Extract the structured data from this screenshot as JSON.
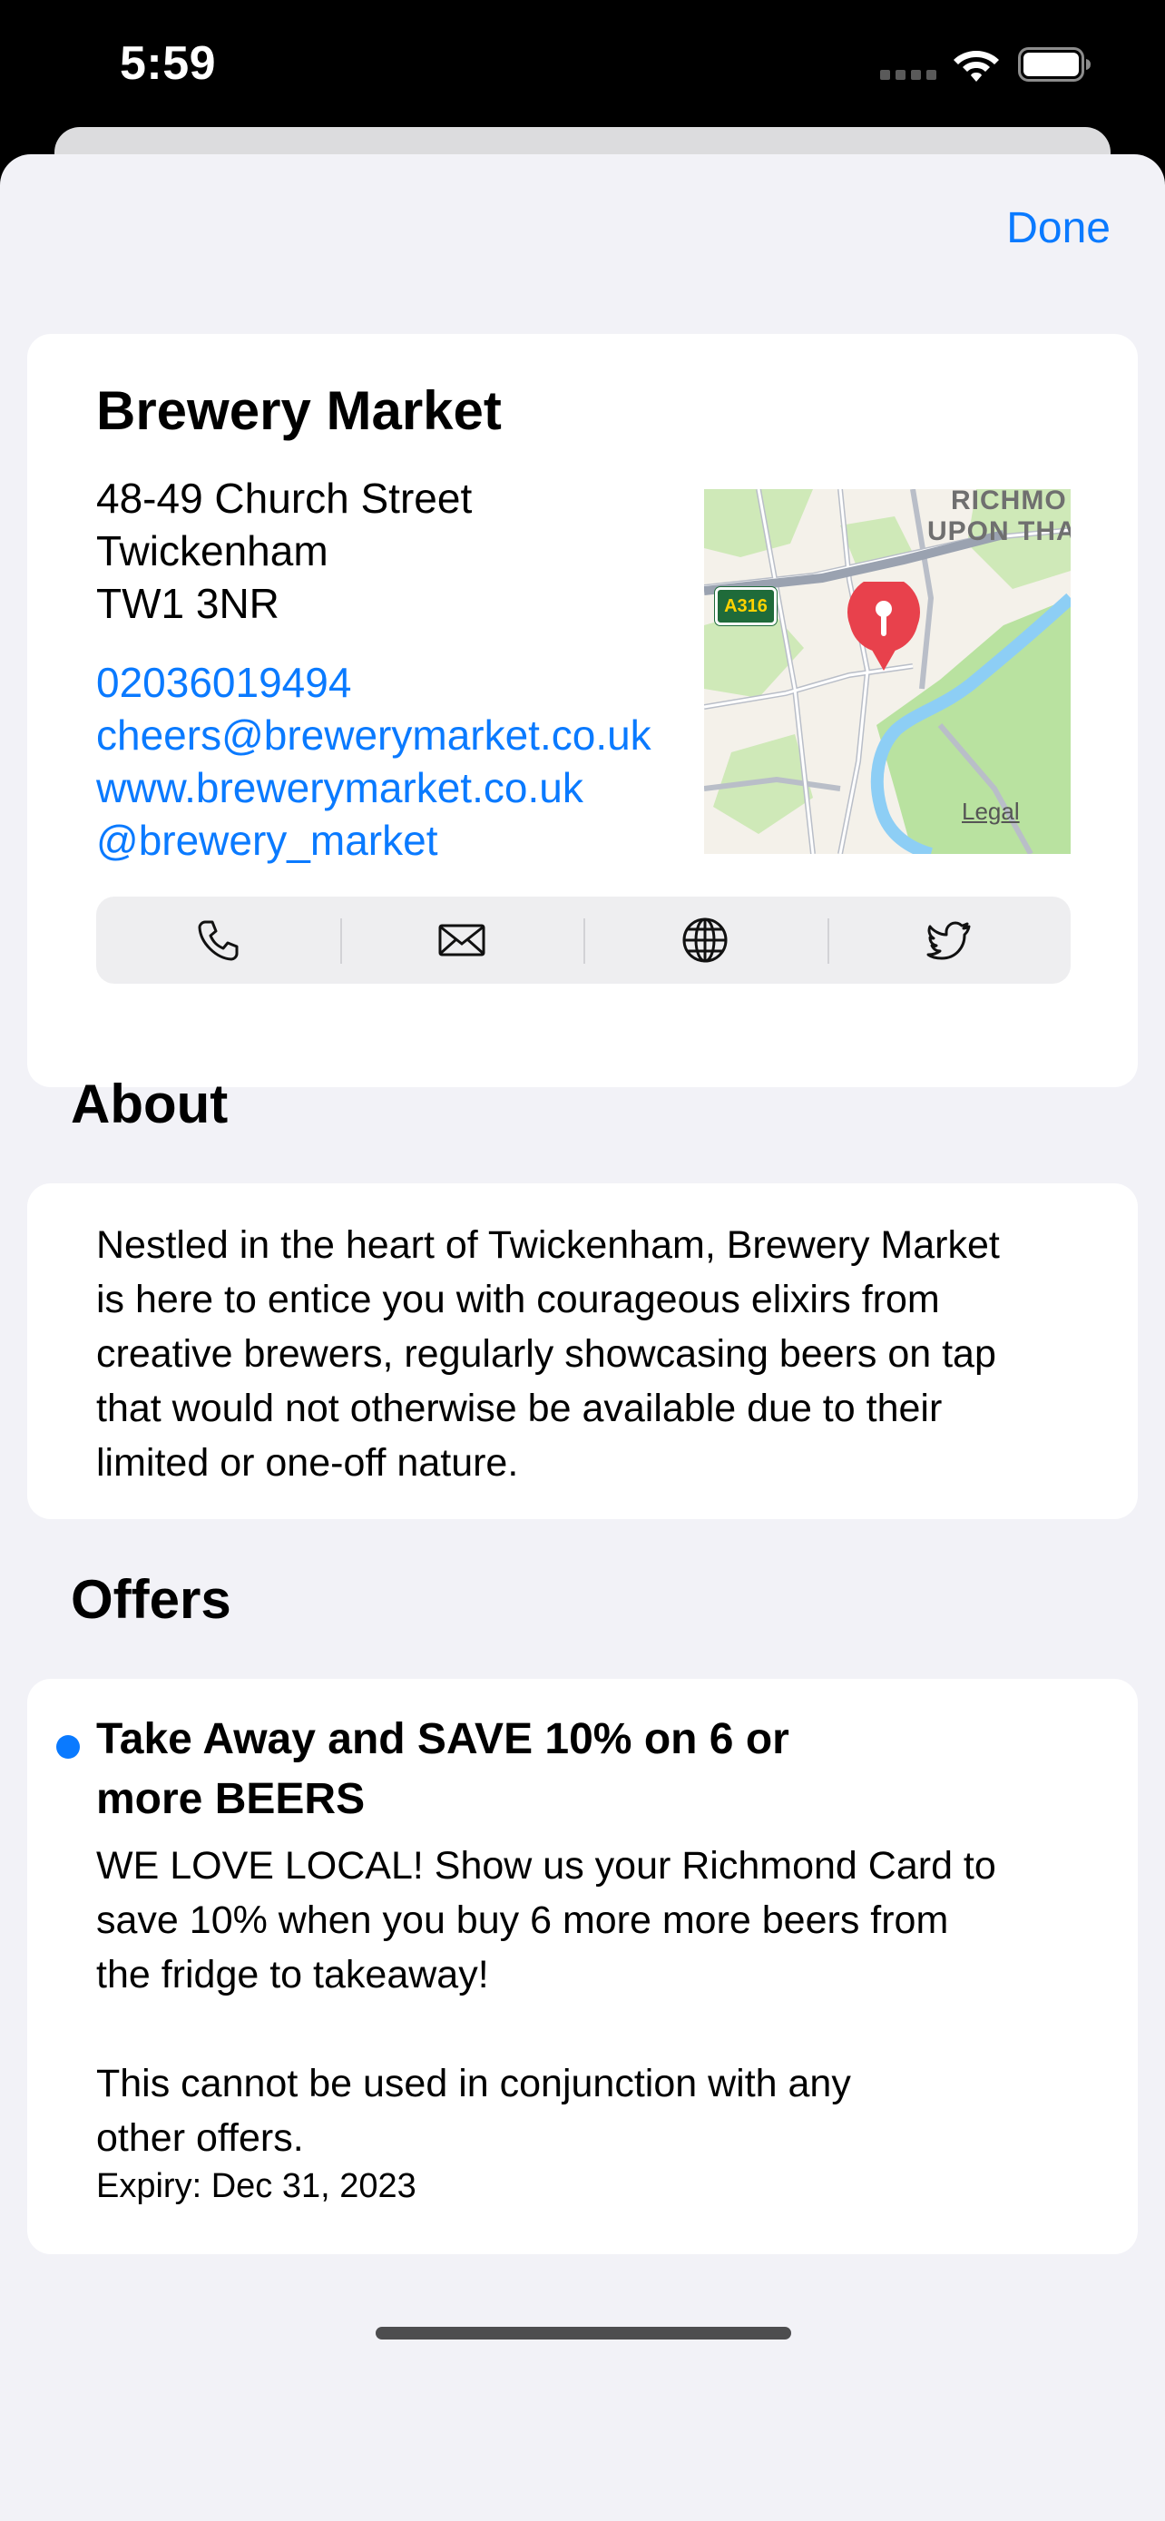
{
  "status_bar": {
    "time": "5:59"
  },
  "nav": {
    "done_label": "Done"
  },
  "place": {
    "name": "Brewery Market",
    "address_lines": [
      "48-49 Church Street",
      "Twickenham",
      "TW1 3NR"
    ],
    "phone": "02036019494",
    "email": "cheers@brewerymarket.co.uk",
    "website": "www.brewerymarket.co.uk",
    "twitter": "@brewery_market"
  },
  "map": {
    "label_line1": "RICHMO",
    "label_line2": "UPON THA",
    "road_badge": "A316",
    "legal": "Legal"
  },
  "actions": [
    {
      "icon": "phone-icon"
    },
    {
      "icon": "mail-icon"
    },
    {
      "icon": "globe-icon"
    },
    {
      "icon": "twitter-icon"
    }
  ],
  "about": {
    "title": "About",
    "lines": [
      "Nestled in the heart of Twickenham, Brewery Market",
      "is here to entice you with courageous elixirs from",
      "creative brewers, regularly showcasing beers on tap",
      "that would not otherwise be available due to their",
      "limited or one-off nature."
    ]
  },
  "offers": {
    "title": "Offers",
    "items": [
      {
        "title_lines": [
          "Take Away and SAVE 10% on 6 or",
          "more BEERS"
        ],
        "body_lines": [
          "WE LOVE LOCAL! Show us your Richmond Card to",
          "save 10% when you buy 6 more more beers from",
          "the fridge to takeaway!"
        ],
        "note_lines": [
          "This cannot be used in conjunction with any",
          "other offers."
        ],
        "expiry": "Expiry: Dec 31, 2023"
      }
    ]
  },
  "colors": {
    "accent": "#0a7aff",
    "background": "#f2f2f7",
    "card": "#ffffff"
  }
}
